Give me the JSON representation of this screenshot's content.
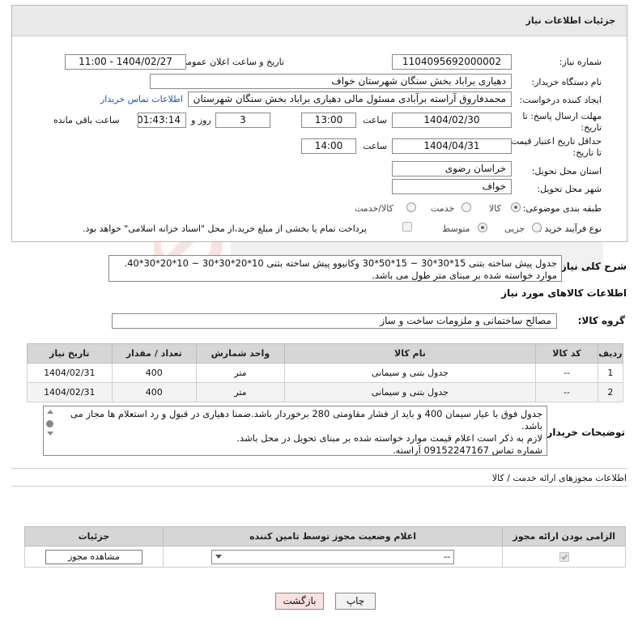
{
  "page": {
    "title": "جزئیات اطلاعات نیاز"
  },
  "fields": {
    "need_number_label": "شماره نیاز:",
    "need_number": "1104095692000002",
    "announce_label": "تاریخ و ساعت اعلان عمومی:",
    "announce_value": "1404/02/27 - 11:00",
    "buyer_org_label": "نام دستگاه خریدار:",
    "buyer_org": "دهیاری براباد بخش سنگان شهرستان خواف",
    "creator_label": "ایجاد کننده درخواست:",
    "creator": "محمدفاروق آراسته برآبادی مسئول مالی دهیاری براباد بخش سنگان شهرستان",
    "contact_link": "اطلاعات تماس خریدار",
    "deadline_label_1": "مهلت ارسال پاسخ: تا",
    "deadline_label_2": "تاریخ:",
    "deadline_date": "1404/02/30",
    "time_label": "ساعت",
    "deadline_time": "13:00",
    "days_value": "3",
    "days_label": "روز و",
    "remaining_time": "01:43:14",
    "remaining_label": "ساعت باقی مانده",
    "validity_label_1": "حداقل تاریخ اعتبار قیمت:",
    "validity_label_2": "تا تاریخ:",
    "validity_date": "1404/04/31",
    "validity_time": "14:00",
    "province_label": "استان محل تحویل:",
    "province": "خراسان رضوی",
    "city_label": "شهر محل تحویل:",
    "city": "خواف",
    "category_label": "طبقه بندی موضوعی:",
    "category_options": [
      "کالا",
      "خدمت",
      "کالا/خدمت"
    ],
    "process_label": "نوع فرآیند خرید :",
    "process_options": [
      "جزیی",
      "متوسط"
    ],
    "payment_note": "پرداخت تمام یا بخشی از مبلغ خرید،از محل \"اسناد خزانه اسلامی\" خواهد بود."
  },
  "description": {
    "label": "شرح کلی نیاز:",
    "line1": "جدول پیش ساخته بتنی 15*30*30 ~ 15*50*30 وکانیوو پیش ساخته بتنی 10*20*30*30 ~ 10*20*30*40.",
    "line2": "موارد خواسته شده بر مبنای متر طول می باشد."
  },
  "goods": {
    "section_title": "اطلاعات کالاهای مورد نیاز",
    "group_label": "گروه کالا:",
    "group_value": "مصالح ساختمانی و ملزومات ساخت و ساز",
    "headers": [
      "ردیف",
      "کد کالا",
      "نام کالا",
      "واحد شمارش",
      "تعداد / مقدار",
      "تاریخ نیاز"
    ],
    "rows": [
      {
        "idx": "1",
        "code": "--",
        "name": "جدول بتنی و سیمانی",
        "unit": "متر",
        "qty": "400",
        "date": "1404/02/31"
      },
      {
        "idx": "2",
        "code": "--",
        "name": "جدول بتنی و سیمانی",
        "unit": "متر",
        "qty": "400",
        "date": "1404/02/31"
      }
    ]
  },
  "buyer_notes": {
    "label": "توضیحات خریدار:",
    "line1": "جدول فوق با عیار سیمان 400 و باید از فشار مقاومتی 280 برخوردار باشد.ضمنا دهیاری در قبول و رد استعلام ها مجاز می",
    "line2": "باشد.",
    "line3": "لازم به ذکر است اعلام قیمت موارد خواسته شده بر مبنای تحویل در محل باشد.",
    "line4": "شماره تماس 09152247167 آراسته."
  },
  "permits": {
    "section_title": "اطلاعات مجوزهای ارائه خدمت / کالا",
    "headers": [
      "الزامی بودن ارائه مجوز",
      "اعلام وضعیت مجوز توسط تامین کننده",
      "جزئیات"
    ],
    "select_value": "--",
    "view_button": "مشاهده مجوز"
  },
  "actions": {
    "print": "چاپ",
    "back": "بازگشت"
  }
}
